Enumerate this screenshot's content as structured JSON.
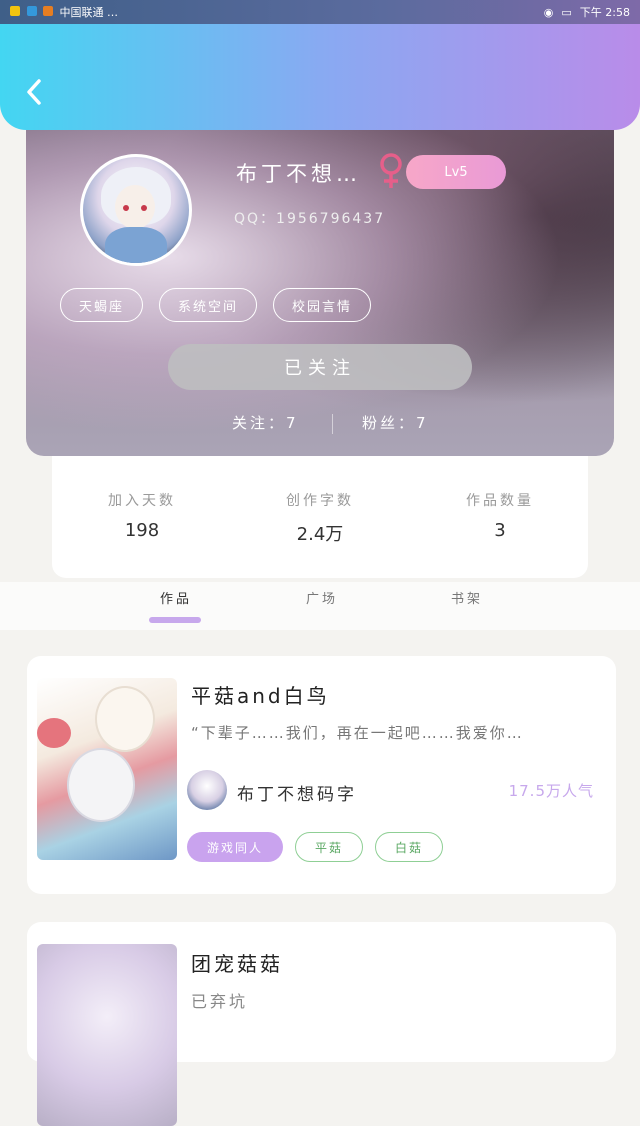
{
  "status_bar": {
    "left_text": "中国联通 …",
    "right_text": "下午 2:58"
  },
  "header": {
    "back_icon": "chevron-left-icon"
  },
  "profile": {
    "name": "布丁不想…",
    "gender_icon": "female-icon",
    "gender_color": "#e65f8a",
    "level": "Lv5",
    "qq": "QQ：1956796437",
    "tags": [
      "天蝎座",
      "系统空间",
      "校园言情"
    ],
    "follow_button": "已关注",
    "following": "关注：7",
    "fans": "粉丝：7"
  },
  "stats": [
    {
      "label": "加入天数",
      "value": "198"
    },
    {
      "label": "创作字数",
      "value": "2.4万"
    },
    {
      "label": "作品数量",
      "value": "3"
    }
  ],
  "tabs": [
    "作品",
    "广场",
    "书架"
  ],
  "works": [
    {
      "title": "平菇and白鸟",
      "quote": "“下辈子……我们，再在一起吧……我爱你…",
      "author": "布丁不想码字",
      "popularity": "17.5万人气",
      "tags": [
        "游戏同人",
        "平菇",
        "白菇"
      ]
    },
    {
      "title": "团宠菇菇",
      "subtitle": "已弃坑"
    }
  ]
}
